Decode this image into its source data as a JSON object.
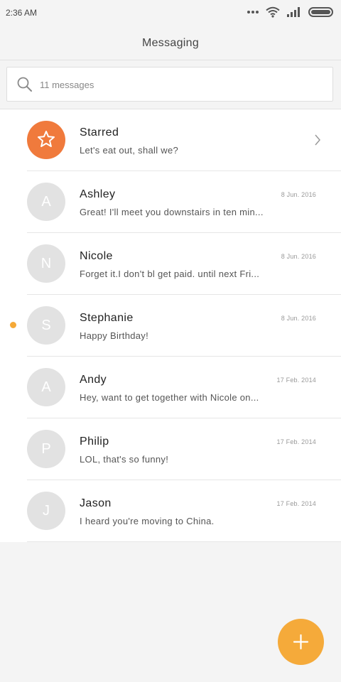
{
  "status_bar": {
    "time": "2:36 AM",
    "icons": [
      "more-dots-icon",
      "wifi-icon",
      "signal-icon",
      "battery-icon"
    ]
  },
  "header": {
    "title": "Messaging"
  },
  "search": {
    "placeholder": "11 messages",
    "icon": "search-icon"
  },
  "messages": [
    {
      "name": "Starred",
      "preview": "Let's eat out, shall we?",
      "date": "",
      "initial": "",
      "icon": "star-icon"
    },
    {
      "name": "Ashley",
      "preview": "Great! I'll meet you downstairs in ten min...",
      "date": "8 Jun. 2016",
      "initial": "A"
    },
    {
      "name": "Nicole",
      "preview": "Forget it.I don't bl get paid. until next Fri...",
      "date": "8 Jun. 2016",
      "initial": "N"
    },
    {
      "name": "Stephanie",
      "preview": "Happy Birthday!",
      "date": "8 Jun. 2016",
      "initial": "S",
      "unread": true
    },
    {
      "name": "Andy",
      "preview": "Hey, want to get together with Nicole on...",
      "date": "17 Feb. 2014",
      "initial": "A"
    },
    {
      "name": "Philip",
      "preview": "LOL, that's so funny!",
      "date": "17 Feb. 2014",
      "initial": "P"
    },
    {
      "name": "Jason",
      "preview": "I heard you're moving to China.",
      "date": "17 Feb. 2014",
      "initial": "J"
    }
  ],
  "fab": {
    "icon": "plus-icon"
  },
  "colors": {
    "starred_avatar": "#f07a3c",
    "avatar": "#e2e2e2",
    "unread_dot": "#f5a937",
    "fab": "#f5aa3a",
    "background": "#f4f4f4"
  }
}
